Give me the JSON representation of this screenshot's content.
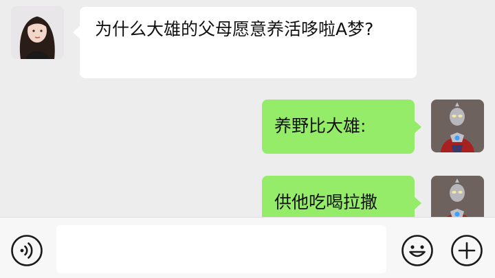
{
  "messages": [
    {
      "sender": "incoming",
      "text": "为什么大雄的父母愿意养活哆啦A梦?"
    },
    {
      "sender": "outgoing",
      "text": "养野比大雄:"
    },
    {
      "sender": "outgoing",
      "text": "供他吃喝拉撒"
    }
  ],
  "input": {
    "value": "",
    "placeholder": ""
  },
  "icons": {
    "voice": "voice-icon",
    "emoji": "emoji-icon",
    "more": "plus-icon"
  },
  "colors": {
    "background": "#ededed",
    "incoming_bubble": "#ffffff",
    "outgoing_bubble": "#95ec69",
    "input_bar": "#f7f7f7"
  }
}
